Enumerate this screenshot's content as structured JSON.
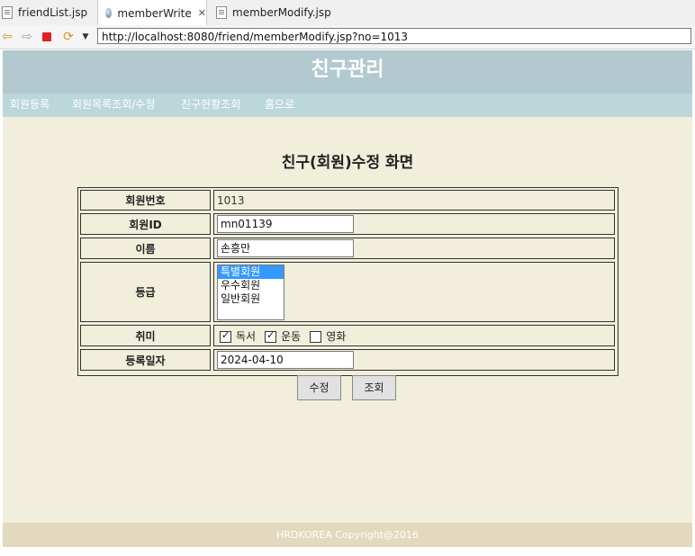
{
  "tabs": [
    {
      "label": "friendList.jsp",
      "icon": "jsp-file-icon"
    },
    {
      "label": "memberWrite",
      "icon": "browser-globe-icon",
      "close": "✕"
    },
    {
      "label": "memberModify.jsp",
      "icon": "jsp-file-icon"
    }
  ],
  "toolbar": {
    "url": "http://localhost:8080/friend/memberModify.jsp?no=1013"
  },
  "header": {
    "title": "친구관리"
  },
  "nav": [
    {
      "label": "회원등록"
    },
    {
      "label": "회원목록조회/수정"
    },
    {
      "label": "친구현황조회"
    },
    {
      "label": "홈으로"
    }
  ],
  "form": {
    "title": "친구(회원)수정 화면",
    "member_no_label": "회원번호",
    "member_no_value": "1013",
    "member_id_label": "회원ID",
    "member_id_value": "mn01139",
    "name_label": "이름",
    "name_value": "손흥만",
    "grade_label": "등급",
    "grade_options": [
      "특별회원",
      "우수회원",
      "일반회원"
    ],
    "grade_selected": "특별회원",
    "hobby_label": "취미",
    "hobbies": [
      {
        "label": "독서",
        "checked": true
      },
      {
        "label": "운동",
        "checked": true
      },
      {
        "label": "영화",
        "checked": false
      }
    ],
    "date_label": "등록일자",
    "date_value": "2024-04-10",
    "modify_button": "수정",
    "list_button": "조회"
  },
  "footer": {
    "text": "HRDKOREA Copyright@2016"
  },
  "colors": {
    "header_bg": "#b2c9cf",
    "nav_bg": "#bcd7da",
    "content_bg": "#f1eedb",
    "footer_bg": "#e2d9be",
    "selection": "#3399ff"
  }
}
